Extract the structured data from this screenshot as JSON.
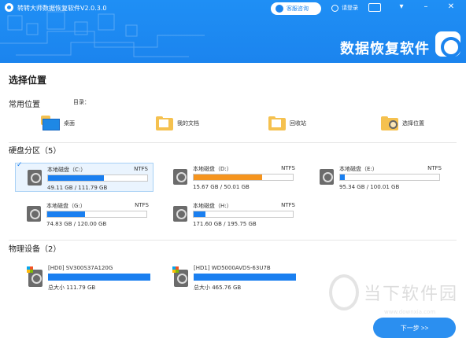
{
  "titlebar": {
    "app_title": "转转大师数据恢复软件V2.0.3.0",
    "consult_label": "客服咨询",
    "login_label": "请登录"
  },
  "header": {
    "brand": "数据恢复软件"
  },
  "page": {
    "title": "选择位置"
  },
  "common": {
    "title": "常用位置",
    "dir_label": "目录：",
    "items": [
      {
        "label": "桌面",
        "icon": "desktop-icon"
      },
      {
        "label": "我的文档",
        "icon": "documents-folder-icon"
      },
      {
        "label": "回收站",
        "icon": "recycle-bin-icon"
      },
      {
        "label": "选择位置",
        "icon": "browse-location-icon"
      }
    ]
  },
  "partitions": {
    "title": "硬盘分区（5）",
    "items": [
      {
        "name": "本地磁盘（C:）",
        "fs": "NTFS",
        "size": "49.11 GB / 111.79 GB",
        "fraction": 0.56,
        "color": "#1a7ff0",
        "selected": true
      },
      {
        "name": "本地磁盘（D:）",
        "fs": "NTFS",
        "size": "15.67 GB / 50.01 GB",
        "fraction": 0.69,
        "color": "#f5941e",
        "selected": false
      },
      {
        "name": "本地磁盘（E:）",
        "fs": "NTFS",
        "size": "95.34 GB / 100.01 GB",
        "fraction": 0.05,
        "color": "#1a7ff0",
        "selected": false
      },
      {
        "name": "本地磁盘（G:）",
        "fs": "NTFS",
        "size": "74.83 GB / 120.00 GB",
        "fraction": 0.38,
        "color": "#1a7ff0",
        "selected": false
      },
      {
        "name": "本地磁盘（H:）",
        "fs": "NTFS",
        "size": "171.60 GB / 195.75 GB",
        "fraction": 0.12,
        "color": "#1a7ff0",
        "selected": false
      }
    ]
  },
  "devices": {
    "title": "物理设备（2）",
    "items": [
      {
        "name": "[HD0] SV300S37A120G",
        "size": "总大小 111.79 GB"
      },
      {
        "name": "[HD1] WD5000AVDS-63U7B",
        "size": "总大小 465.76 GB"
      }
    ]
  },
  "footer": {
    "next_label": "下一步 >>"
  },
  "watermark": {
    "text": "当下软件园",
    "url": "www.downxia.com"
  },
  "colors": {
    "accent": "#1b84ee",
    "warning": "#f5941e"
  }
}
